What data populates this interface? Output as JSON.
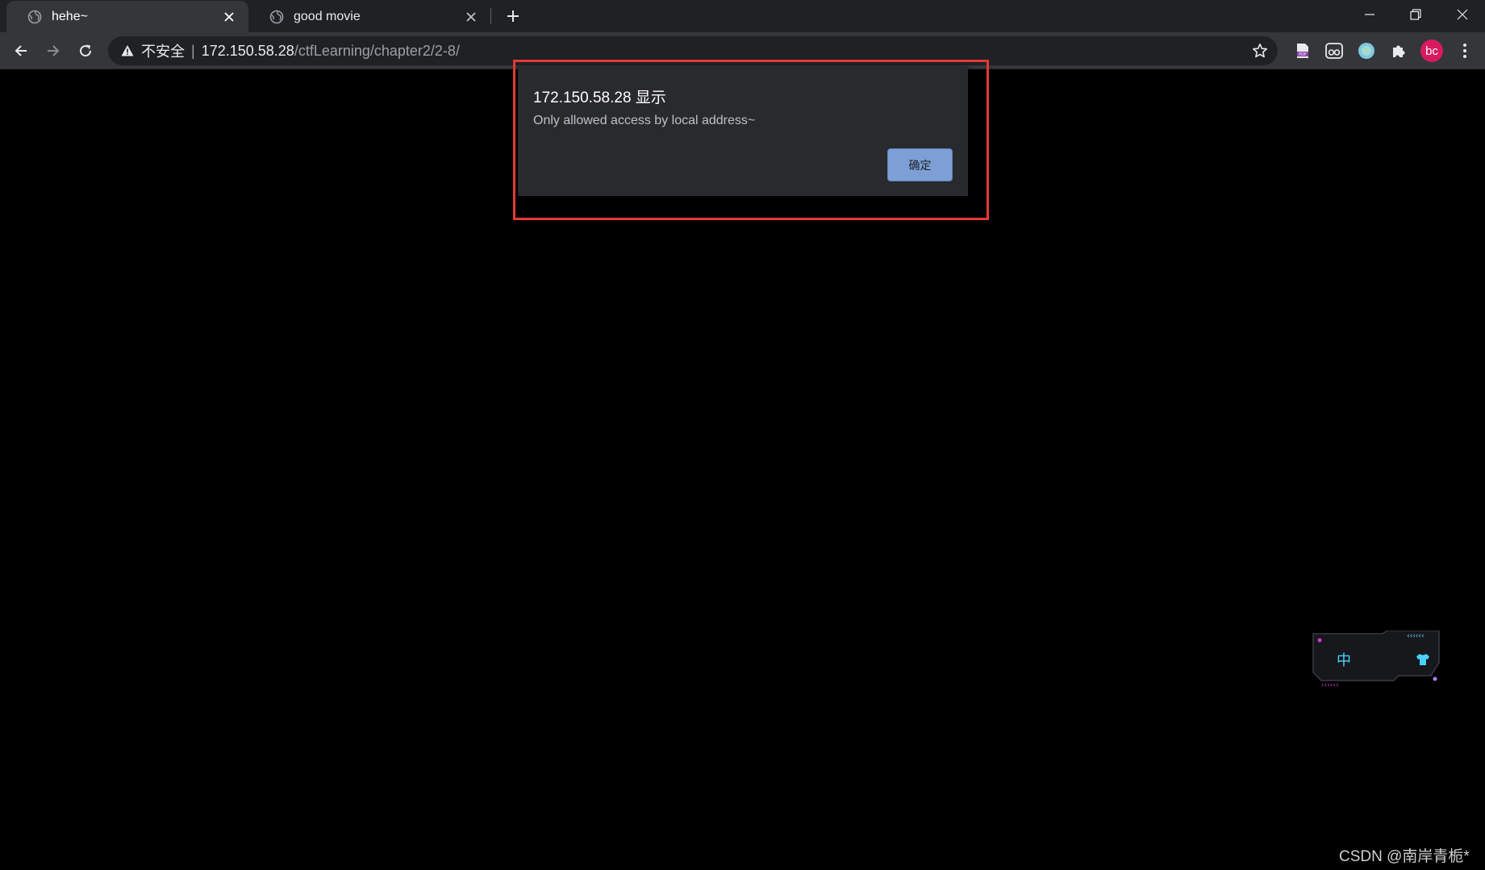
{
  "tabs": [
    {
      "title": "hehe~",
      "active": true
    },
    {
      "title": "good movie",
      "active": false
    }
  ],
  "address_bar": {
    "security_label": "不安全",
    "separator": "|",
    "host": "172.150.58.28",
    "path": "/ctfLearning/chapter2/2-8/"
  },
  "profile": {
    "initials": "bc",
    "color": "#d81b60"
  },
  "dialog": {
    "title": "172.150.58.28 显示",
    "message": "Only allowed access by local address~",
    "ok_label": "确定"
  },
  "widget": {
    "lang_label": "中"
  },
  "watermark": "CSDN @南岸青栀*",
  "colors": {
    "highlight": "#e53935",
    "ok_button": "#7d9fd6",
    "page_background": "#000000"
  }
}
